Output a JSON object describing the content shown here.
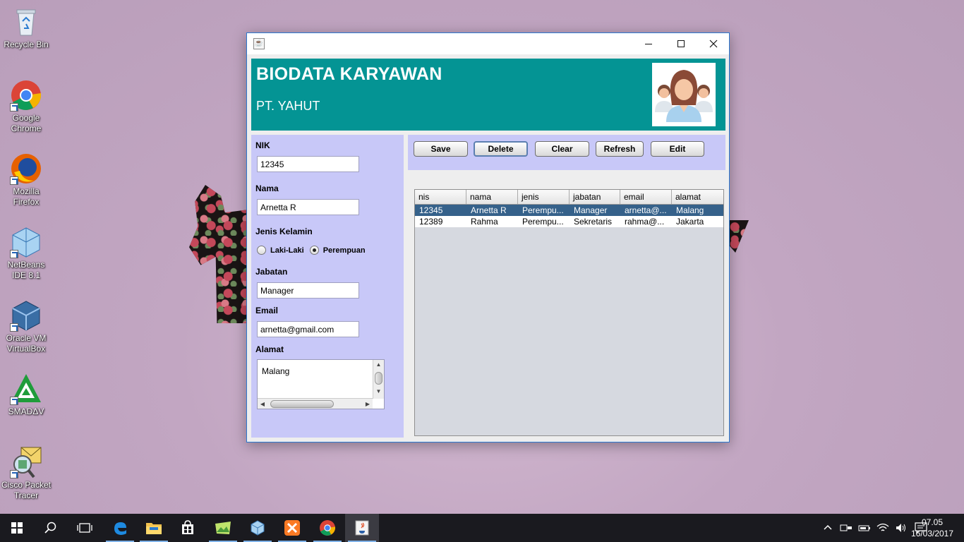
{
  "desktop": {
    "icons": [
      {
        "label": "Recycle Bin",
        "icon": "recycle-bin-icon"
      },
      {
        "label": "Google Chrome",
        "icon": "chrome-icon"
      },
      {
        "label": "Mozilla Firefox",
        "icon": "firefox-icon"
      },
      {
        "label": "NetBeans IDE 8.1",
        "icon": "netbeans-icon"
      },
      {
        "label": "Oracle VM VirtualBox",
        "icon": "virtualbox-icon"
      },
      {
        "label": "SMADΔV",
        "icon": "smadav-icon"
      },
      {
        "label": "Cisco Packet Tracer",
        "icon": "packet-tracer-icon"
      }
    ]
  },
  "window": {
    "app_icon": "java-icon",
    "controls": {
      "minimize": "minimize-icon",
      "maximize": "maximize-icon",
      "close": "close-icon"
    }
  },
  "header": {
    "title": "BIODATA KARYAWAN",
    "subtitle": "PT. YAHUT",
    "logo_icon": "employees-logo-icon",
    "bg_color": "#049494"
  },
  "form": {
    "nik_label": "NIK",
    "nik_value": "12345",
    "nama_label": "Nama",
    "nama_value": "Arnetta R",
    "jenis_label": "Jenis Kelamin",
    "gender_options": [
      "Laki-Laki",
      "Perempuan"
    ],
    "gender_selected": "Perempuan",
    "jabatan_label": "Jabatan",
    "jabatan_value": "Manager",
    "email_label": "Email",
    "email_value": "arnetta@gmail.com",
    "alamat_label": "Alamat",
    "alamat_value": "Malang",
    "panel_color": "#c8c8f8"
  },
  "buttons": {
    "save": "Save",
    "delete": "Delete",
    "clear": "Clear",
    "refresh": "Refresh",
    "edit": "Edit"
  },
  "table": {
    "columns": [
      "nis",
      "nama",
      "jenis",
      "jabatan",
      "email",
      "alamat"
    ],
    "rows": [
      [
        "12345",
        "Arnetta R",
        "Perempu...",
        "Manager",
        "arnetta@...",
        "Malang"
      ],
      [
        "12389",
        "Rahma",
        "Perempu...",
        "Sekretaris",
        "rahma@...",
        "Jakarta"
      ]
    ],
    "selected_row": 0,
    "selection_color": "#35618a"
  },
  "taskbar": {
    "items": [
      "windows-start-icon",
      "search-icon",
      "task-view-icon",
      "edge-icon",
      "file-explorer-icon",
      "store-icon",
      "photos-icon",
      "netbeans-icon",
      "xampp-icon",
      "chrome-icon",
      "java-icon"
    ],
    "tray_icons": [
      "chevron-up-icon",
      "network-device-icon",
      "battery-icon",
      "wifi-icon",
      "volume-icon",
      "notification-icon"
    ],
    "time": "07.05",
    "date": "16/03/2017"
  }
}
